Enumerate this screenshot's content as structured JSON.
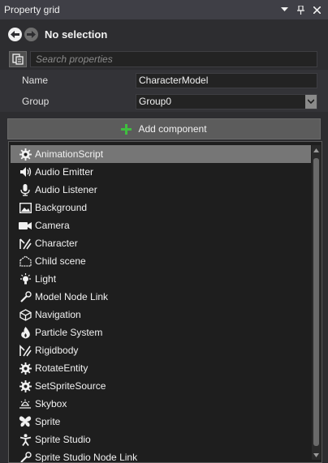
{
  "titlebar": {
    "title": "Property grid",
    "menu_icon": "chevron-down-icon",
    "pin_icon": "pin-icon",
    "close_icon": "close-icon"
  },
  "nav": {
    "back_icon": "back-arrow-icon",
    "forward_icon": "forward-arrow-icon",
    "selection_label": "No selection"
  },
  "search": {
    "placeholder": "Search properties",
    "value": ""
  },
  "properties": [
    {
      "label": "Name",
      "value": "CharacterModel"
    },
    {
      "label": "Group",
      "value": "Group0"
    }
  ],
  "add_component": {
    "label": "Add component",
    "icon": "plus-icon",
    "accent": "#3fbf3f"
  },
  "components": [
    {
      "label": "AnimationScript",
      "icon": "gear-icon",
      "selected": true
    },
    {
      "label": "Audio Emitter",
      "icon": "speaker-icon"
    },
    {
      "label": "Audio Listener",
      "icon": "microphone-icon"
    },
    {
      "label": "Background",
      "icon": "image-icon"
    },
    {
      "label": "Camera",
      "icon": "camera-icon"
    },
    {
      "label": "Character",
      "icon": "character-icon"
    },
    {
      "label": "Child scene",
      "icon": "child-scene-icon"
    },
    {
      "label": "Light",
      "icon": "lightbulb-icon"
    },
    {
      "label": "Model Node Link",
      "icon": "link-icon"
    },
    {
      "label": "Navigation",
      "icon": "cube-icon"
    },
    {
      "label": "Particle System",
      "icon": "flame-icon"
    },
    {
      "label": "Rigidbody",
      "icon": "rigidbody-icon"
    },
    {
      "label": "RotateEntity",
      "icon": "gear-icon"
    },
    {
      "label": "SetSpriteSource",
      "icon": "gear-icon"
    },
    {
      "label": "Skybox",
      "icon": "skybox-icon"
    },
    {
      "label": "Sprite",
      "icon": "butterfly-icon"
    },
    {
      "label": "Sprite Studio",
      "icon": "figure-icon"
    },
    {
      "label": "Sprite Studio Node Link",
      "icon": "link-icon"
    }
  ]
}
